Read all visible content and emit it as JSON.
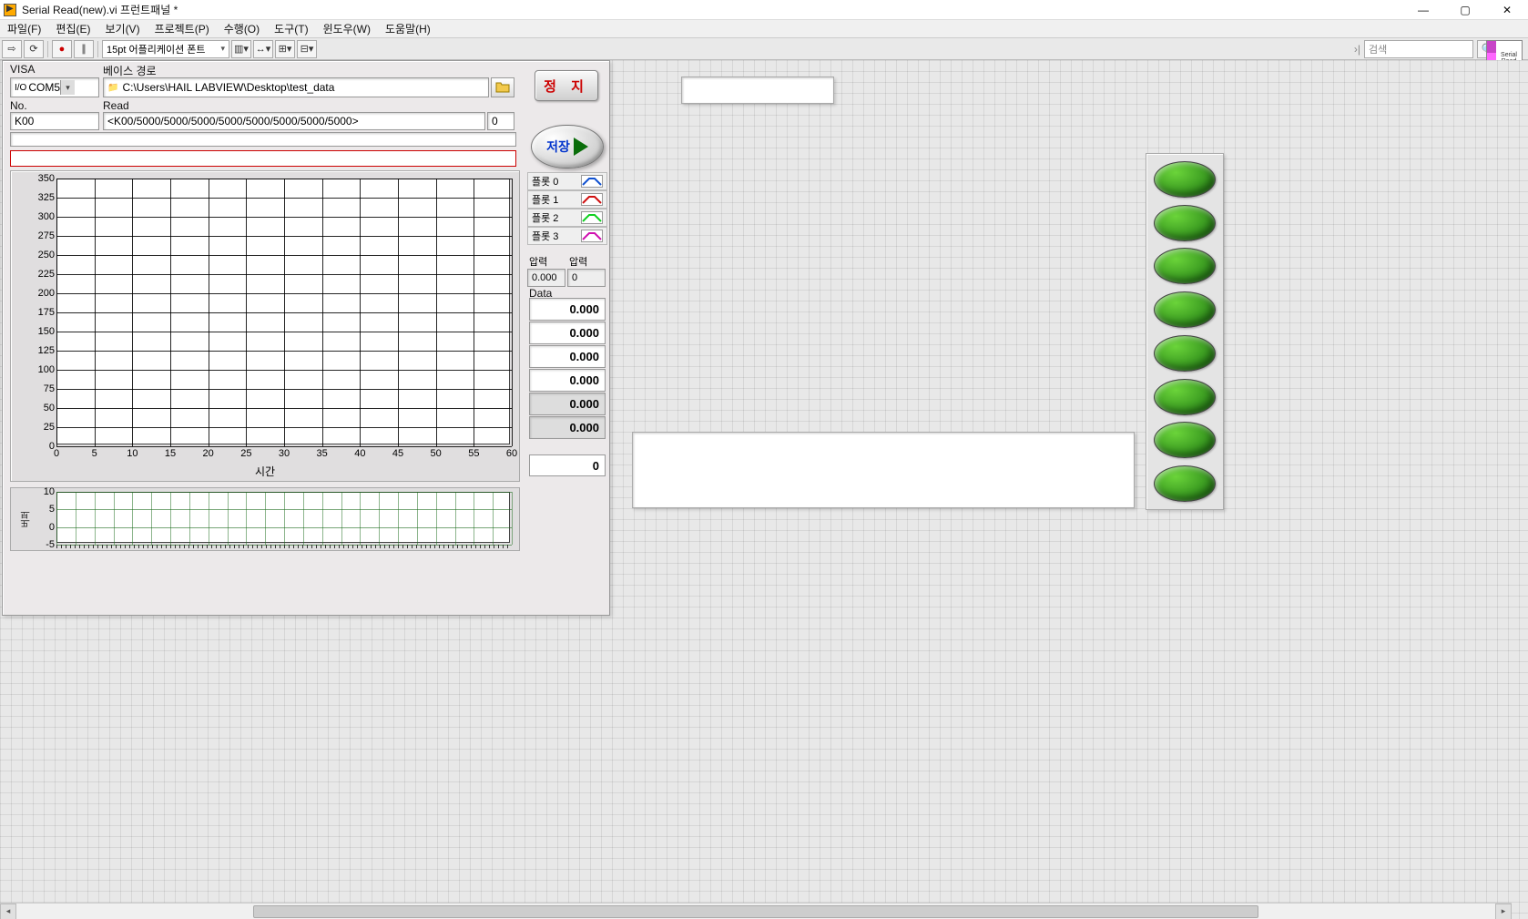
{
  "window": {
    "title": "Serial Read(new).vi 프런트패널 *"
  },
  "menu": {
    "file": "파일(F)",
    "edit": "편집(E)",
    "view": "보기(V)",
    "project": "프로젝트(P)",
    "run": "수행(O)",
    "tools": "도구(T)",
    "window": "윈도우(W)",
    "help": "도움말(H)"
  },
  "toolbar": {
    "font": "15pt 어플리케이션 폰트",
    "search_placeholder": "검색"
  },
  "vi_icon": {
    "l1": "Serial",
    "l2": "Read"
  },
  "labels": {
    "visa": "VISA",
    "path": "베이스 경로",
    "no": "No.",
    "read": "Read",
    "stop": "정 지",
    "save": "저장",
    "pressure1": "압력",
    "pressure2": "압력",
    "data": "Data",
    "xaxis": "시간",
    "smallY": "버퍼"
  },
  "inputs": {
    "visa": "COM5",
    "path": "C:\\Users\\HAIL LABVIEW\\Desktop\\test_data",
    "no": "K00",
    "read": "<K00/5000/5000/5000/5000/5000/5000/5000/5000>",
    "readcount": "0",
    "blank1": "",
    "blank2": "",
    "pressure_in": "0.000",
    "pressure_out": "0",
    "counter": "0"
  },
  "data_vals": [
    "0.000",
    "0.000",
    "0.000",
    "0.000",
    "0.000",
    "0.000"
  ],
  "legend": [
    {
      "label": "플롯 0",
      "color": "#1050d0"
    },
    {
      "label": "플롯 1",
      "color": "#d01010"
    },
    {
      "label": "플롯 2",
      "color": "#10d020"
    },
    {
      "label": "플롯 3",
      "color": "#d010b0"
    }
  ],
  "chart_data": {
    "type": "line",
    "title": "",
    "xlabel": "시간",
    "ylabel": "",
    "xlim": [
      0,
      60
    ],
    "ylim": [
      0,
      350
    ],
    "x_ticks": [
      0,
      5,
      10,
      15,
      20,
      25,
      30,
      35,
      40,
      45,
      50,
      55,
      60
    ],
    "y_ticks": [
      0,
      25,
      50,
      75,
      100,
      125,
      150,
      175,
      200,
      225,
      250,
      275,
      300,
      325,
      350
    ],
    "series": [
      {
        "name": "플롯 0",
        "color": "#1050d0",
        "values": []
      },
      {
        "name": "플롯 1",
        "color": "#d01010",
        "values": []
      },
      {
        "name": "플롯 2",
        "color": "#10d020",
        "values": []
      },
      {
        "name": "플롯 3",
        "color": "#d010b0",
        "values": []
      }
    ],
    "secondary": {
      "type": "line",
      "ylim": [
        -5,
        10
      ],
      "y_ticks": [
        -5,
        0,
        5,
        10
      ],
      "values": []
    }
  }
}
